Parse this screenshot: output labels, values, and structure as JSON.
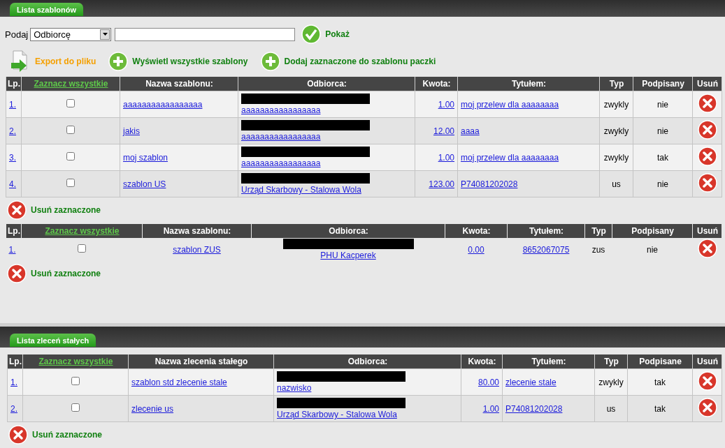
{
  "panels": [
    {
      "tab": "Lista szablonów",
      "search": {
        "label": "Podaj",
        "select": "Odbiorcę",
        "button": "Pokaż"
      },
      "actions": [
        {
          "kind": "export",
          "label": "Export do pliku"
        },
        {
          "kind": "add",
          "label": "Wyświetl wszystkie szablony"
        },
        {
          "kind": "add",
          "label": "Dodaj zaznaczone do szablonu paczki"
        }
      ],
      "tables": [
        {
          "kind": "grid",
          "columns": [
            "Lp.",
            "Zaznacz wszystkie",
            "Nazwa szablonu:",
            "Odbiorca:",
            "Kwota:",
            "Tytułem:",
            "Typ",
            "Podpisany",
            "Usuń"
          ],
          "rows": [
            {
              "lp": "1.",
              "checked": false,
              "name": "aaaaaaaaaaaaaaaaa",
              "recipient": "aaaaaaaaaaaaaaaaa",
              "amount": "1.00",
              "title": "moj przelew dla aaaaaaaa",
              "type": "zwykly",
              "signed": "nie"
            },
            {
              "lp": "2.",
              "checked": false,
              "name": "jakis",
              "recipient": "aaaaaaaaaaaaaaaaa",
              "amount": "12.00",
              "title": "aaaa",
              "type": "zwykly",
              "signed": "nie"
            },
            {
              "lp": "3.",
              "checked": false,
              "name": "moj szablon",
              "recipient": "aaaaaaaaaaaaaaaaa",
              "amount": "1.00",
              "title": "moj przelew dla aaaaaaaa",
              "type": "zwykly",
              "signed": "tak"
            },
            {
              "lp": "4.",
              "checked": false,
              "name": "szablon US",
              "recipient": "Urząd Skarbowy - Stalowa Wola",
              "amount": "123.00",
              "title": "P74081202028",
              "type": "us",
              "signed": "nie"
            }
          ],
          "delete_label": "Usuń zaznaczone"
        },
        {
          "kind": "plain",
          "columns": [
            "Lp.",
            "Zaznacz wszystkie",
            "Nazwa szablonu:",
            "Odbiorca:",
            "Kwota:",
            "Tytułem:",
            "Typ",
            "Podpisany",
            "Usuń"
          ],
          "rows": [
            {
              "lp": "1.",
              "checked": false,
              "name": "szablon ZUS",
              "recipient": "PHU Kacperek",
              "amount": "0.00",
              "title": "8652067075",
              "type": "zus",
              "signed": "nie"
            }
          ],
          "delete_label": "Usuń zaznaczone"
        }
      ]
    },
    {
      "tab": "Lista zleceń stałych",
      "tables": [
        {
          "kind": "grid",
          "columns": [
            "Lp.",
            "Zaznacz wszystkie",
            "Nazwa zlecenia stałego",
            "Odbiorca:",
            "Kwota:",
            "Tytułem:",
            "Typ",
            "Podpisane",
            "Usuń"
          ],
          "rows": [
            {
              "lp": "1.",
              "checked": false,
              "name": "szablon std zlecenie stale",
              "recipient": "nazwisko",
              "amount": "80.00",
              "title": "zlecenie stale",
              "type": "zwykly",
              "signed": "tak"
            },
            {
              "lp": "2.",
              "checked": false,
              "name": "zlecenie us",
              "recipient": "Urząd Skarbowy - Stalowa Wola",
              "amount": "1.00",
              "title": "P74081202028",
              "type": "us",
              "signed": "tak"
            }
          ],
          "delete_label": "Usuń zaznaczone"
        }
      ]
    }
  ]
}
